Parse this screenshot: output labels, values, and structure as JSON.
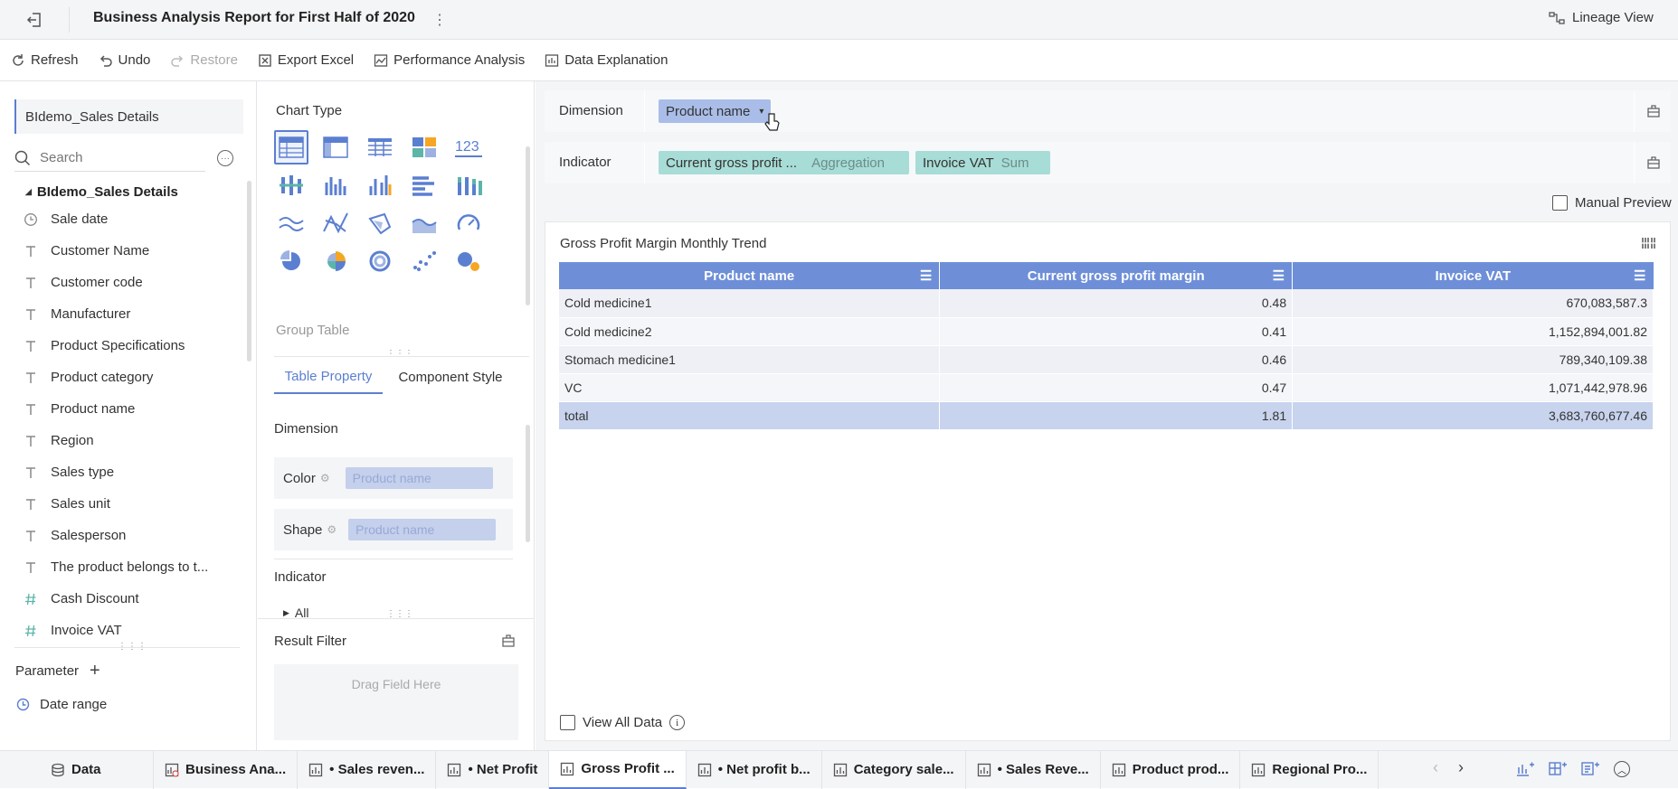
{
  "header": {
    "title": "Business Analysis Report for First Half of 2020",
    "lineage_label": "Lineage View"
  },
  "toolbar": {
    "refresh": "Refresh",
    "undo": "Undo",
    "restore": "Restore",
    "export": "Export Excel",
    "performance": "Performance Analysis",
    "explanation": "Data Explanation"
  },
  "left": {
    "dataset_tab": "BIdemo_Sales Details",
    "search_placeholder": "Search",
    "tree_root": "BIdemo_Sales Details",
    "fields": [
      {
        "label": "Sale date",
        "type": "date"
      },
      {
        "label": "Customer Name",
        "type": "text"
      },
      {
        "label": "Customer code",
        "type": "text"
      },
      {
        "label": "Manufacturer",
        "type": "text"
      },
      {
        "label": "Product Specifications",
        "type": "text"
      },
      {
        "label": "Product category",
        "type": "text"
      },
      {
        "label": "Product name",
        "type": "text"
      },
      {
        "label": "Region",
        "type": "text"
      },
      {
        "label": "Sales type",
        "type": "text"
      },
      {
        "label": "Sales unit",
        "type": "text"
      },
      {
        "label": "Salesperson",
        "type": "text"
      },
      {
        "label": "The product belongs to t...",
        "type": "text"
      },
      {
        "label": "Cash Discount",
        "type": "number"
      },
      {
        "label": "Invoice VAT",
        "type": "number"
      }
    ],
    "parameter_label": "Parameter",
    "param_items": [
      {
        "label": "Date range"
      }
    ]
  },
  "middle": {
    "chart_type_label": "Chart Type",
    "selected_chart_name": "Group Table",
    "tabs": [
      "Table Property",
      "Component Style"
    ],
    "dimension_label": "Dimension",
    "color_label": "Color",
    "color_value": "Product name",
    "shape_label": "Shape",
    "shape_value": "Product name",
    "indicator_label": "Indicator",
    "indicator_all": "All",
    "result_filter_label": "Result Filter",
    "drag_field_here": "Drag Field Here"
  },
  "config": {
    "dimension_label": "Dimension",
    "dimension_pill": "Product name",
    "indicator_label": "Indicator",
    "indicator_pills": [
      {
        "name": "Current gross profit ...",
        "agg": "Aggregation"
      },
      {
        "name": "Invoice VAT",
        "agg": "Sum"
      }
    ],
    "manual_preview": "Manual Preview"
  },
  "widget": {
    "title": "Gross Profit Margin Monthly Trend",
    "columns": [
      "Product name",
      "Current gross profit margin",
      "Invoice VAT"
    ],
    "rows": [
      [
        "Cold medicine1",
        "0.48",
        "670,083,587.3"
      ],
      [
        "Cold medicine2",
        "0.41",
        "1,152,894,001.82"
      ],
      [
        "Stomach medicine1",
        "0.46",
        "789,340,109.38"
      ],
      [
        "VC",
        "0.47",
        "1,071,442,978.96"
      ]
    ],
    "total": [
      "total",
      "1.81",
      "3,683,760,677.46"
    ],
    "view_all": "View All Data"
  },
  "bottom_tabs": [
    {
      "label": "Data",
      "icon": "database-icon"
    },
    {
      "label": "Business Ana...",
      "icon": "dashboard-icon"
    },
    {
      "label": "• Sales reven...",
      "icon": "chart-icon"
    },
    {
      "label": "• Net Profit",
      "icon": "chart-icon"
    },
    {
      "label": "Gross Profit ...",
      "icon": "chart-icon",
      "active": true
    },
    {
      "label": "• Net profit b...",
      "icon": "chart-icon"
    },
    {
      "label": "Category sale...",
      "icon": "chart-icon"
    },
    {
      "label": "• Sales Reve...",
      "icon": "chart-icon"
    },
    {
      "label": "Product prod...",
      "icon": "chart-icon"
    },
    {
      "label": "Regional Pro...",
      "icon": "chart-icon"
    }
  ],
  "colors": {
    "accent": "#5b7fd0",
    "header_blue": "#6e8fd8",
    "teal_pill": "#a8dcd6",
    "dim_pill": "#a9bde8"
  }
}
